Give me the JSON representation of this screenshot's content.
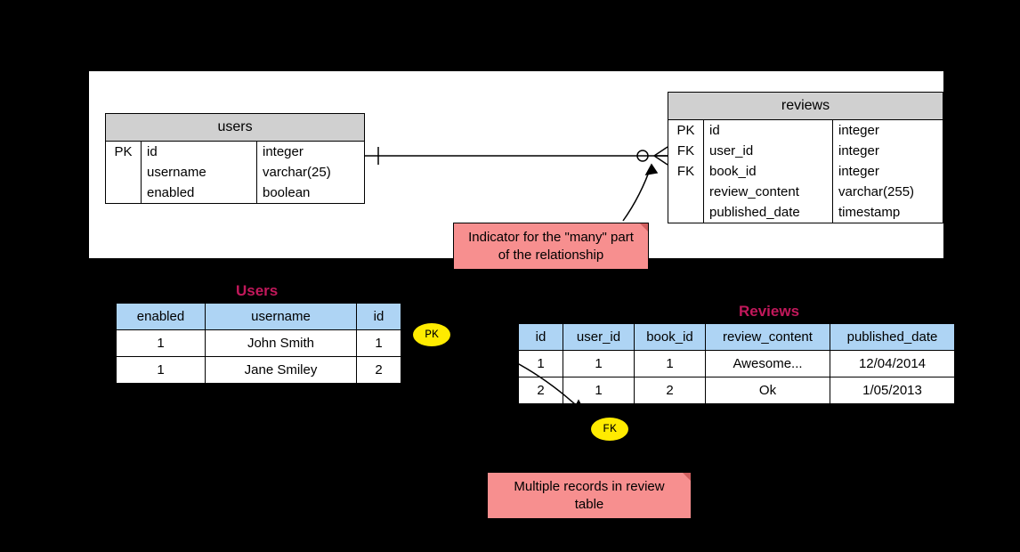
{
  "entities": {
    "users": {
      "title": "users",
      "columns": [
        {
          "key": "PK",
          "name": "id",
          "type": "integer"
        },
        {
          "key": "",
          "name": "username",
          "type": "varchar(25)"
        },
        {
          "key": "",
          "name": "enabled",
          "type": "boolean"
        }
      ]
    },
    "reviews": {
      "title": "reviews",
      "columns": [
        {
          "key": "PK",
          "name": "id",
          "type": "integer"
        },
        {
          "key": "FK",
          "name": "user_id",
          "type": "integer"
        },
        {
          "key": "FK",
          "name": "book_id",
          "type": "integer"
        },
        {
          "key": "",
          "name": "review_content",
          "type": "varchar(255)"
        },
        {
          "key": "",
          "name": "published_date",
          "type": "timestamp"
        }
      ]
    }
  },
  "callouts": {
    "many": "Indicator for the \"many\" part of the relationship",
    "multiple": "Multiple records in review table"
  },
  "badges": {
    "pk": "PK",
    "fk": "FK"
  },
  "tables": {
    "users": {
      "title": "Users",
      "headers": [
        "enabled",
        "username",
        "id"
      ],
      "rows": [
        [
          "1",
          "John Smith",
          "1"
        ],
        [
          "1",
          "Jane Smiley",
          "2"
        ]
      ]
    },
    "reviews": {
      "title": "Reviews",
      "headers": [
        "id",
        "user_id",
        "book_id",
        "review_content",
        "published_date"
      ],
      "rows": [
        [
          "1",
          "1",
          "1",
          "Awesome...",
          "12/04/2014"
        ],
        [
          "2",
          "1",
          "2",
          "Ok",
          "1/05/2013"
        ]
      ]
    }
  }
}
